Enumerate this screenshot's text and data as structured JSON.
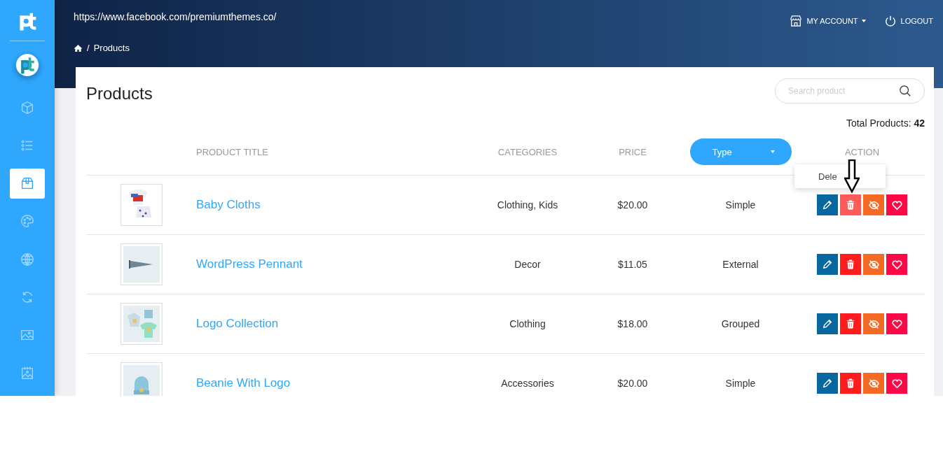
{
  "sidebar": {
    "items": [
      {
        "selected": false
      },
      {
        "selected": false
      },
      {
        "selected": true
      },
      {
        "selected": false
      },
      {
        "selected": false
      },
      {
        "selected": false
      },
      {
        "selected": false
      },
      {
        "selected": false
      }
    ]
  },
  "header": {
    "url": "https://www.facebook.com/premiumthemes.co/",
    "breadcrumb": [
      "/",
      "Products"
    ],
    "account": "MY ACCOUNT",
    "logout": "LOGOUT"
  },
  "page": {
    "title": "Products",
    "search": {
      "placeholder": "Search product"
    },
    "total_label": "Total Products:",
    "total": "42"
  },
  "table": {
    "columns": [
      "PRODUCT TITLE",
      "CATEGORIES",
      "PRICE",
      "Type",
      "ACTION"
    ],
    "tooltip": "Dele",
    "rows": [
      {
        "title": "Baby Cloths",
        "categories": "Clothing, Kids",
        "price": "$20.00",
        "type": "Simple",
        "delete_hovered": true
      },
      {
        "title": "WordPress Pennant",
        "categories": "Decor",
        "price": "$11.05",
        "type": "External",
        "delete_hovered": false
      },
      {
        "title": "Logo Collection",
        "categories": "Clothing",
        "price": "$18.00",
        "type": "Grouped",
        "delete_hovered": false
      },
      {
        "title": "Beanie With Logo",
        "categories": "Accessories",
        "price": "$20.00",
        "type": "Simple",
        "delete_hovered": false
      }
    ]
  }
}
